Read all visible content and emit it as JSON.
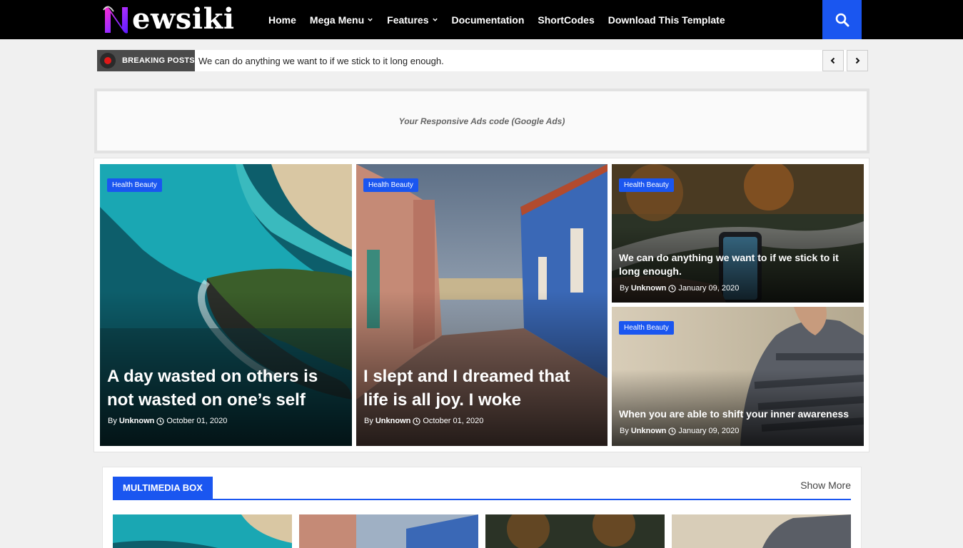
{
  "header": {
    "logo_letter": "N",
    "logo_text": "ewsiki",
    "nav": [
      {
        "label": "Home",
        "dropdown": false
      },
      {
        "label": "Mega Menu",
        "dropdown": true
      },
      {
        "label": "Features",
        "dropdown": true
      },
      {
        "label": "Documentation",
        "dropdown": false
      },
      {
        "label": "ShortCodes",
        "dropdown": false
      },
      {
        "label": "Download This Template",
        "dropdown": false
      }
    ],
    "search_icon": "search-icon"
  },
  "breaking": {
    "label": "BREAKING POSTS",
    "text": "We can do anything we want to if we stick to it long enough."
  },
  "ad": {
    "text": "Your Responsive Ads code (Google Ads)"
  },
  "featured": [
    {
      "tag": "Health Beauty",
      "title": "A day wasted on others is not wasted on one’s self",
      "by": "By",
      "author": "Unknown",
      "date": "October 01, 2020"
    },
    {
      "tag": "Health Beauty",
      "title": "I slept and I dreamed that life is all joy. I woke",
      "by": "By",
      "author": "Unknown",
      "date": "October 01, 2020"
    },
    {
      "tag": "Health Beauty",
      "title": "We can do anything we want to if we stick to it long enough.",
      "by": "By",
      "author": "Unknown",
      "date": "January 09, 2020"
    },
    {
      "tag": "Health Beauty",
      "title": "When you are able to shift your inner awareness",
      "by": "By",
      "author": "Unknown",
      "date": "January 09, 2020"
    }
  ],
  "multimedia": {
    "label": "MULTIMEDIA BOX",
    "more": "Show More"
  },
  "colors": {
    "accent": "#1a56f0",
    "topbar": "#000000",
    "breaking_label": "#4a4a4a"
  }
}
